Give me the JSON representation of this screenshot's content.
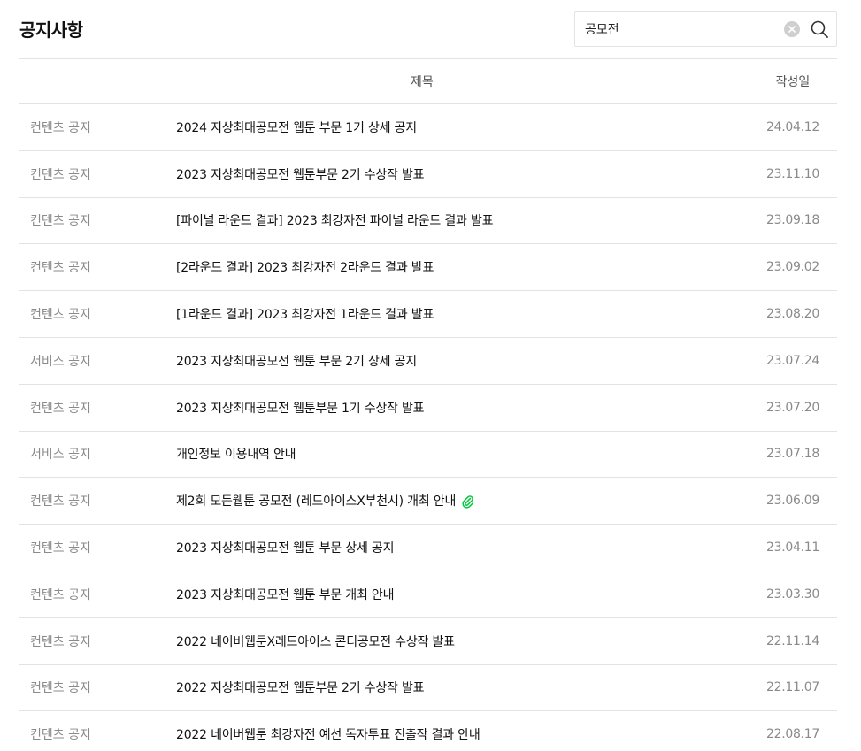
{
  "header": {
    "title": "공지사항"
  },
  "search": {
    "value": "공모전"
  },
  "table": {
    "headers": {
      "category": "",
      "subject": "제목",
      "date": "작성일"
    },
    "rows": [
      {
        "category": "컨텐츠 공지",
        "subject": "2024 지상최대공모전 웹툰 부문 1기 상세 공지",
        "date": "24.04.12"
      },
      {
        "category": "컨텐츠 공지",
        "subject": "2023 지상최대공모전 웹툰부문 2기 수상작 발표",
        "date": "23.11.10"
      },
      {
        "category": "컨텐츠 공지",
        "subject": "[파이널 라운드 결과] 2023 최강자전 파이널 라운드 결과 발표",
        "date": "23.09.18"
      },
      {
        "category": "컨텐츠 공지",
        "subject": "[2라운드 결과] 2023 최강자전 2라운드 결과 발표",
        "date": "23.09.02"
      },
      {
        "category": "컨텐츠 공지",
        "subject": "[1라운드 결과] 2023 최강자전 1라운드 결과 발표",
        "date": "23.08.20"
      },
      {
        "category": "서비스 공지",
        "subject": "2023 지상최대공모전 웹툰 부문 2기 상세 공지",
        "date": "23.07.24"
      },
      {
        "category": "컨텐츠 공지",
        "subject": "2023 지상최대공모전 웹툰부문 1기 수상작 발표",
        "date": "23.07.20"
      },
      {
        "category": "서비스 공지",
        "subject": "개인정보 이용내역 안내",
        "date": "23.07.18"
      },
      {
        "category": "컨텐츠 공지",
        "subject": "제2회 모든웹툰 공모전 (레드아이스X부천시) 개최 안내",
        "date": "23.06.09",
        "attachment": true
      },
      {
        "category": "컨텐츠 공지",
        "subject": "2023 지상최대공모전 웹툰 부문 상세 공지",
        "date": "23.04.11"
      },
      {
        "category": "컨텐츠 공지",
        "subject": "2023 지상최대공모전 웹툰 부문 개최 안내",
        "date": "23.03.30"
      },
      {
        "category": "컨텐츠 공지",
        "subject": "2022 네이버웹툰X레드아이스 콘티공모전 수상작 발표",
        "date": "22.11.14"
      },
      {
        "category": "컨텐츠 공지",
        "subject": "2022 지상최대공모전 웹툰부문 2기 수상작 발표",
        "date": "22.11.07"
      },
      {
        "category": "컨텐츠 공지",
        "subject": "2022 네이버웹툰 최강자전 예선 독자투표 진출작 결과 안내",
        "date": "22.08.17"
      }
    ]
  },
  "icons": {
    "clear": "clear-circle-icon",
    "search": "search-icon",
    "attachment": "paperclip-icon"
  },
  "colors": {
    "attachment": "#00c73c",
    "muted_text": "#8a8a8a",
    "border": "#e3e3e3"
  }
}
